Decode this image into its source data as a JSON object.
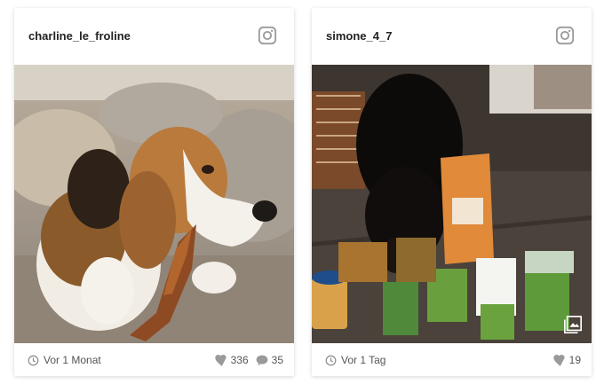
{
  "posts": [
    {
      "username": "charline_le_froline",
      "time": "Vor 1 Monat",
      "likes": "336",
      "comments": "35"
    },
    {
      "username": "simone_4_7",
      "time": "Vor 1 Tag",
      "likes": "19"
    }
  ],
  "icons": {
    "header": "instagram-icon",
    "time": "clock-icon",
    "likes": "heart-icon",
    "comments": "comment-icon",
    "multi": "gallery-icon"
  },
  "colors": {
    "icon_gray": "#9a9a9a",
    "text": "#222222",
    "subtext": "#555555"
  }
}
